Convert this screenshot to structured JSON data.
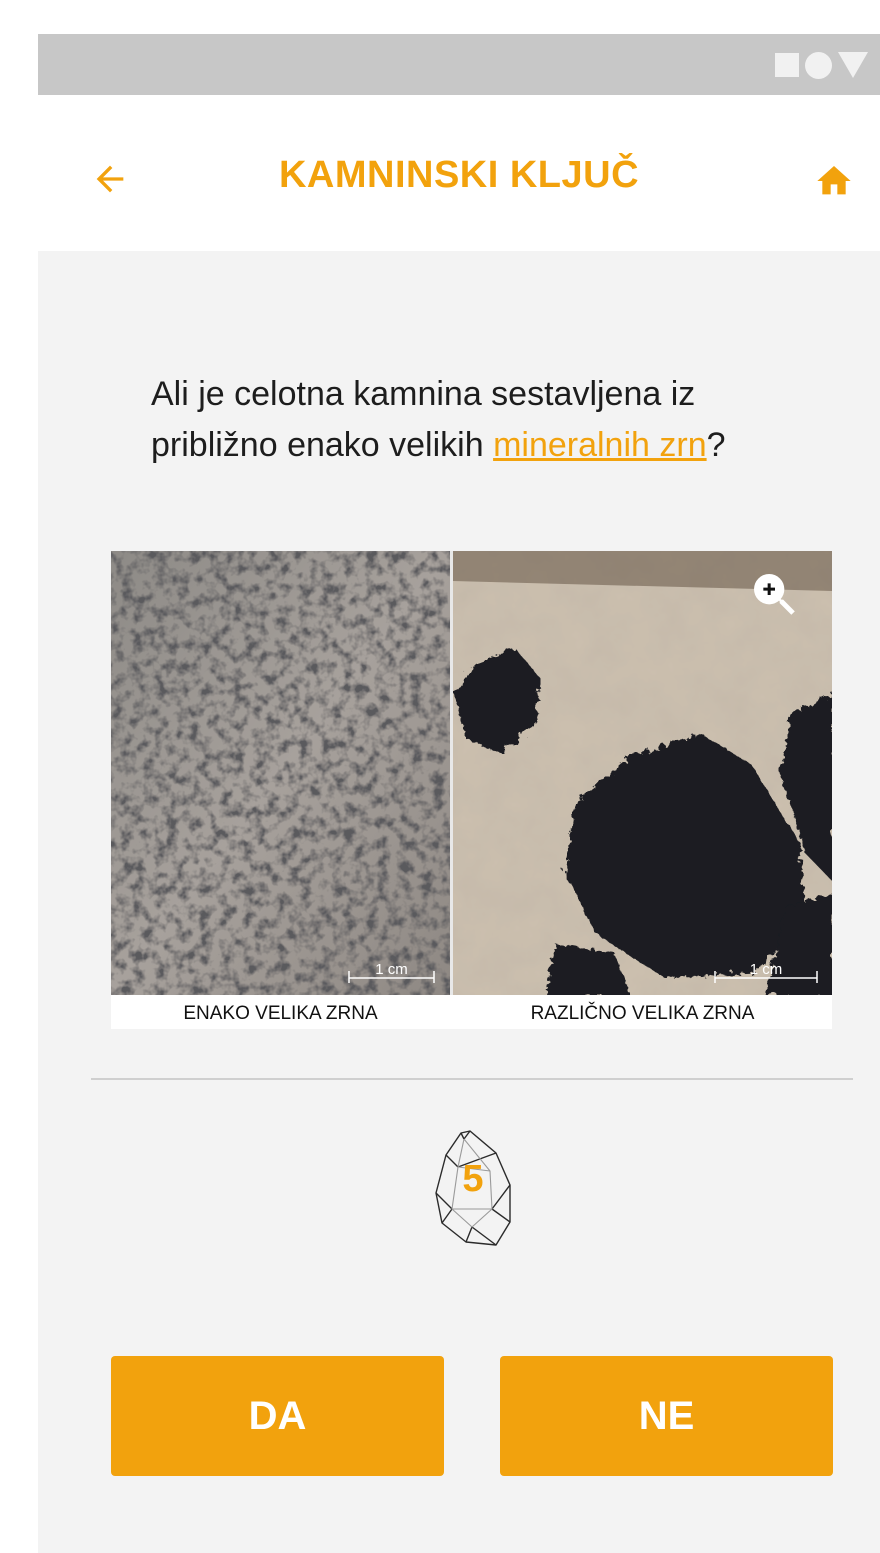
{
  "header": {
    "title": "KAMNINSKI KLJUČ",
    "back_icon": "arrow-left-icon",
    "home_icon": "home-icon",
    "accent_color": "#f2a20d"
  },
  "statusbar": {
    "icons": [
      "square-icon",
      "circle-icon",
      "triangle-icon"
    ]
  },
  "question": {
    "text_before": "Ali je celotna kamnina sestavljena iz približno enako velikih ",
    "link_text": "mineralnih zrn",
    "text_after": "?"
  },
  "images": [
    {
      "caption": "ENAKO VELIKA ZRNA",
      "scale_label": "1 cm"
    },
    {
      "caption": "RAZLIČNO VELIKA ZRNA",
      "scale_label": "1 cm"
    }
  ],
  "zoom_icon": "zoom-in-icon",
  "step": {
    "number": "5",
    "icon": "crystal-icon"
  },
  "buttons": {
    "yes": "DA",
    "no": "NE"
  }
}
